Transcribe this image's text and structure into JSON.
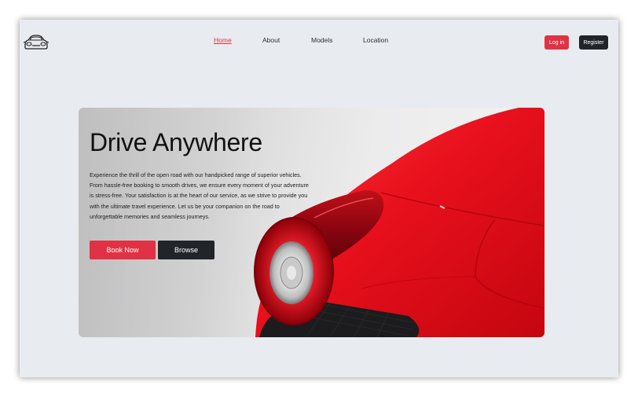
{
  "nav": {
    "items": [
      {
        "label": "Home",
        "active": true
      },
      {
        "label": "About",
        "active": false
      },
      {
        "label": "Models",
        "active": false
      },
      {
        "label": "Location",
        "active": false
      }
    ]
  },
  "auth": {
    "login_label": "Log in",
    "register_label": "Register"
  },
  "hero": {
    "title": "Drive Anywhere",
    "description": "Experience the thrill of the open road with our handpicked range of superior vehicles. From hassle-free booking to smooth drives, we ensure every moment of your adventure is stress-free. Your satisfaction is at the heart of our service, as we strive to provide you with the ultimate travel experience. Let us be your companion on the road to unforgettable memories and seamless journeys.",
    "primary_button": "Book Now",
    "secondary_button": "Browse"
  },
  "colors": {
    "accent": "#e03244",
    "dark": "#212529",
    "page_background": "#e8ebef",
    "car_red": "#e8101c"
  },
  "icons": {
    "logo": "car-front-icon"
  }
}
